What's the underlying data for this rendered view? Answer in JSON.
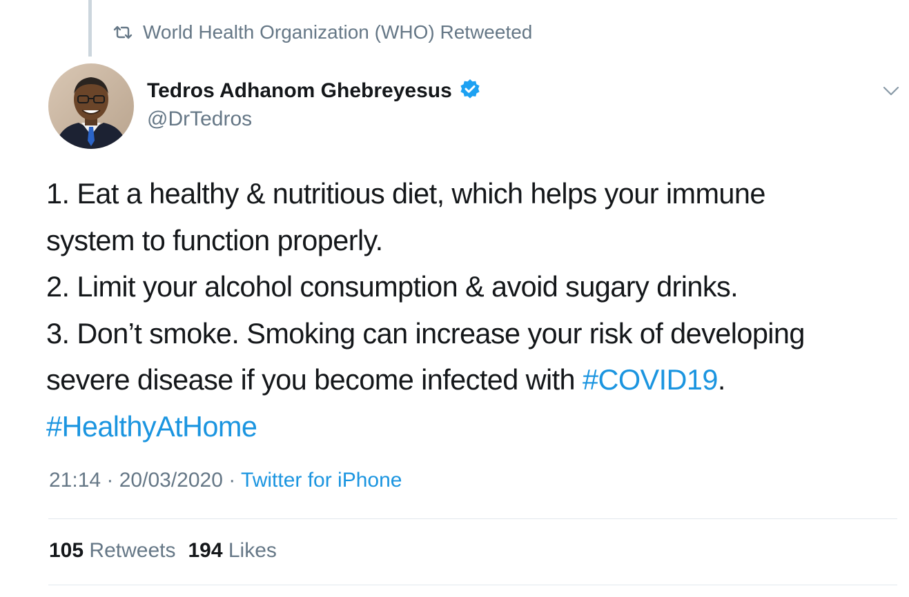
{
  "retweet_context": {
    "icon": "retweet-icon",
    "text": "World Health Organization (WHO) Retweeted"
  },
  "author": {
    "name": "Tedros Adhanom Ghebreyesus",
    "handle": "@DrTedros",
    "verified": true,
    "verified_icon": "verified-badge-icon"
  },
  "tweet": {
    "lines": [
      "1. Eat a healthy & nutritious diet, which helps your immune",
      "system to function properly.",
      "2. Limit your alcohol consumption & avoid sugary drinks.",
      "3. Don’t smoke. Smoking can increase your risk of developing"
    ],
    "line5_text": "severe disease if you become infected with ",
    "hashtag_covid": "#COVID19",
    "line5_end": ".",
    "hashtag_home": "#HealthyAtHome"
  },
  "meta": {
    "time": "21:14",
    "separator": " · ",
    "date": "20/03/2020",
    "source": "Twitter for iPhone"
  },
  "stats": {
    "retweets_count": "105",
    "retweets_label": "Retweets",
    "likes_count": "194",
    "likes_label": "Likes"
  },
  "colors": {
    "link": "#1b95e0",
    "secondary_text": "#657786",
    "primary_text": "#14171a",
    "verified": "#1da1f2",
    "divider": "#e1e8ed"
  }
}
